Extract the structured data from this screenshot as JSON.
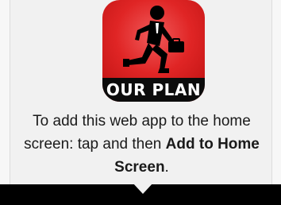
{
  "app_icon": {
    "banner_text": "OUR PLAN",
    "icon_name": "running-man-briefcase-icon",
    "background_color": "#e02525"
  },
  "message": {
    "part1": "To add this web app to the home screen: tap",
    "part2": "and then",
    "bold_action": "Add to Home Screen",
    "end": "."
  }
}
